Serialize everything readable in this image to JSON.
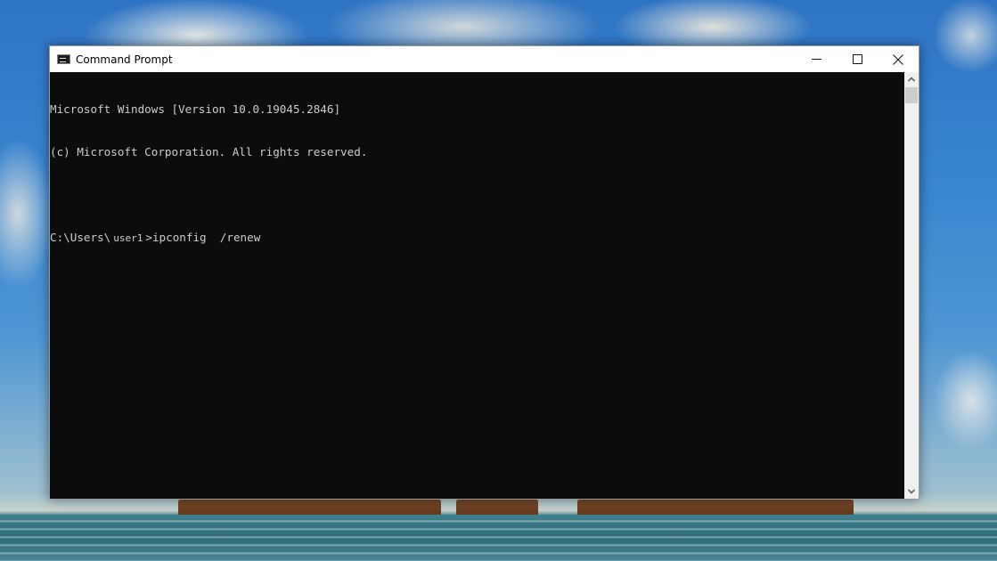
{
  "window": {
    "title": "Command Prompt",
    "icon": "cmd-icon",
    "controls": {
      "minimize": "minimize-icon",
      "maximize": "maximize-icon",
      "close": "close-icon"
    }
  },
  "console": {
    "lines": [
      "Microsoft Windows [Version 10.0.19045.2846]",
      "(c) Microsoft Corporation. All rights reserved.",
      ""
    ],
    "prompt": {
      "path_prefix": "C:\\Users\\",
      "username": "user1",
      "separator": ">",
      "command": "ipconfig  /renew"
    }
  },
  "scrollbar": {
    "up_icon": "chevron-up-icon",
    "down_icon": "chevron-down-icon"
  }
}
